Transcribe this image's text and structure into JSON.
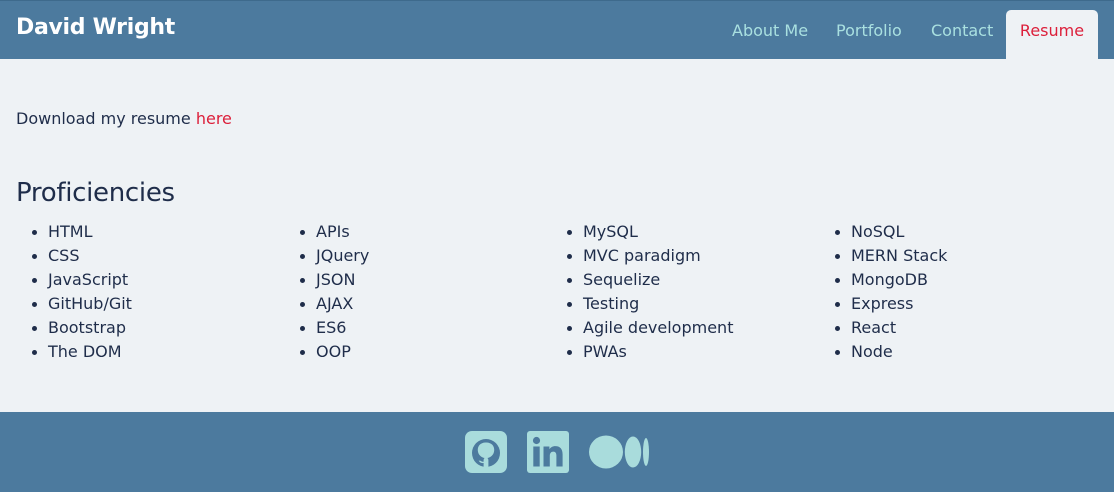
{
  "navbar": {
    "brand": "David Wright",
    "links": [
      {
        "label": "About Me"
      },
      {
        "label": "Portfolio"
      },
      {
        "label": "Contact"
      },
      {
        "label": "Resume"
      }
    ],
    "active": "Resume"
  },
  "resume": {
    "download_prefix": "Download my resume ",
    "download_link": "here"
  },
  "proficiencies": {
    "heading": "Proficiencies",
    "columns": [
      [
        "HTML",
        "CSS",
        "JavaScript",
        "GitHub/Git",
        "Bootstrap",
        "The DOM"
      ],
      [
        "APIs",
        "JQuery",
        "JSON",
        "AJAX",
        "ES6",
        "OOP"
      ],
      [
        "MySQL",
        "MVC paradigm",
        "Sequelize",
        "Testing",
        "Agile development",
        "PWAs"
      ],
      [
        "NoSQL",
        "MERN Stack",
        "MongoDB",
        "Express",
        "React",
        "Node"
      ]
    ]
  },
  "footer": {
    "icons": [
      "github-icon",
      "linkedin-icon",
      "medium-icon"
    ]
  },
  "colors": {
    "navbar_bg": "#4c7a9e",
    "page_bg": "#eef2f5",
    "nav_link": "#a9e0e0",
    "accent_red": "#dc1f3a",
    "text_dark": "#1f2d4a",
    "icon_teal": "#a9dcdc"
  }
}
